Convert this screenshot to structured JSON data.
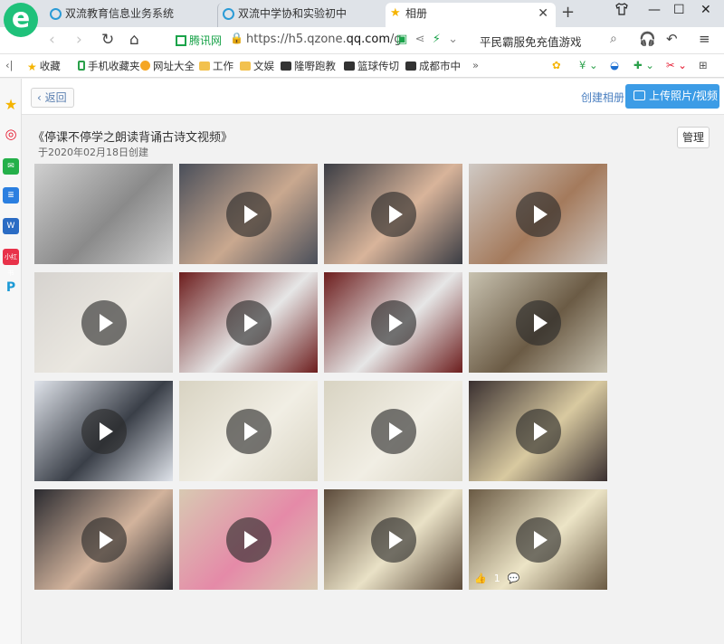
{
  "browser": {
    "logo_letter": "e",
    "tabs": [
      {
        "title": "双流教育信息业务系统",
        "icon": "globe-icon"
      },
      {
        "title": "双流中学协和实验初中",
        "icon": "globe-icon"
      },
      {
        "title": "相册",
        "icon": "star-icon",
        "active": true
      }
    ],
    "new_tab": "+",
    "window_controls": [
      "shirt-icon",
      "minimize-icon",
      "maximize-icon",
      "close-icon"
    ],
    "address": {
      "security_label": "腾讯网",
      "url_prefix": "https://h5.qzone.",
      "url_domain": "qq.com",
      "url_suffix": "/g",
      "search_text": "平民霸服免充值游戏"
    },
    "bookmarks": [
      {
        "label": "收藏",
        "icon": "star-icon"
      },
      {
        "label": "手机收藏夹",
        "icon": "phone-icon"
      },
      {
        "label": "网址大全",
        "icon": "globe-icon"
      },
      {
        "label": "工作",
        "icon": "folder-icon"
      },
      {
        "label": "文娱",
        "icon": "folder-icon"
      },
      {
        "label": "隆嘢跑教",
        "icon": "game-icon"
      },
      {
        "label": "篮球传切",
        "icon": "game-icon"
      },
      {
        "label": "成都市中",
        "icon": "game-icon"
      }
    ],
    "bookmarks_more": "»"
  },
  "sidebar": {
    "icons": [
      {
        "name": "star-icon",
        "color": "#f5b400"
      },
      {
        "name": "weibo-icon",
        "color": "#e6162d"
      },
      {
        "name": "mail-icon",
        "color": "#25b04a"
      },
      {
        "name": "doc-icon",
        "color": "#2b7fe0"
      },
      {
        "name": "word-icon",
        "color": "#2b6cc4"
      },
      {
        "name": "miniprogram-icon",
        "color": "#e8324a",
        "label": "小红书"
      },
      {
        "name": "pinterest-icon",
        "color": "#1c9ad6"
      }
    ]
  },
  "header": {
    "back_label": "返回",
    "create_album": "创建相册",
    "upload": "上传照片/视频"
  },
  "album": {
    "title": "《停课不停学之朗读背诵古诗文视频》",
    "created": "于2020年02月18日创建",
    "manage": "管理",
    "items": [
      {
        "bg": "#cfcfcf",
        "accent": "#8a8a8a",
        "play": false
      },
      {
        "bg": "#4a4f5a",
        "accent": "#c9a88f",
        "play": true
      },
      {
        "bg": "#3b3d44",
        "accent": "#d8b49a",
        "play": true
      },
      {
        "bg": "#cfc9c4",
        "accent": "#a47a5c",
        "play": true
      },
      {
        "bg": "#d6d3cf",
        "accent": "#eae7e0",
        "play": true
      },
      {
        "bg": "#6d1e1e",
        "accent": "#e6e6e6",
        "play": true
      },
      {
        "bg": "#6d1e1e",
        "accent": "#e6e6e6",
        "play": true
      },
      {
        "bg": "#c8c2b0",
        "accent": "#6b5b45",
        "play": true
      },
      {
        "bg": "#dfe3ea",
        "accent": "#3a3f48",
        "play": true
      },
      {
        "bg": "#d8d3c2",
        "accent": "#f1eee4",
        "play": true
      },
      {
        "bg": "#d8d3c2",
        "accent": "#f1eee4",
        "play": true
      },
      {
        "bg": "#3a3030",
        "accent": "#d8c9a0",
        "play": true
      },
      {
        "bg": "#2b2b30",
        "accent": "#d2b39c",
        "play": true
      },
      {
        "bg": "#d8c9b2",
        "accent": "#e58aa8",
        "play": true
      },
      {
        "bg": "#5b4a3a",
        "accent": "#e9e1c6",
        "play": true
      },
      {
        "bg": "#6a5a44",
        "accent": "#ece4c6",
        "play": true,
        "likes": "1"
      }
    ]
  }
}
